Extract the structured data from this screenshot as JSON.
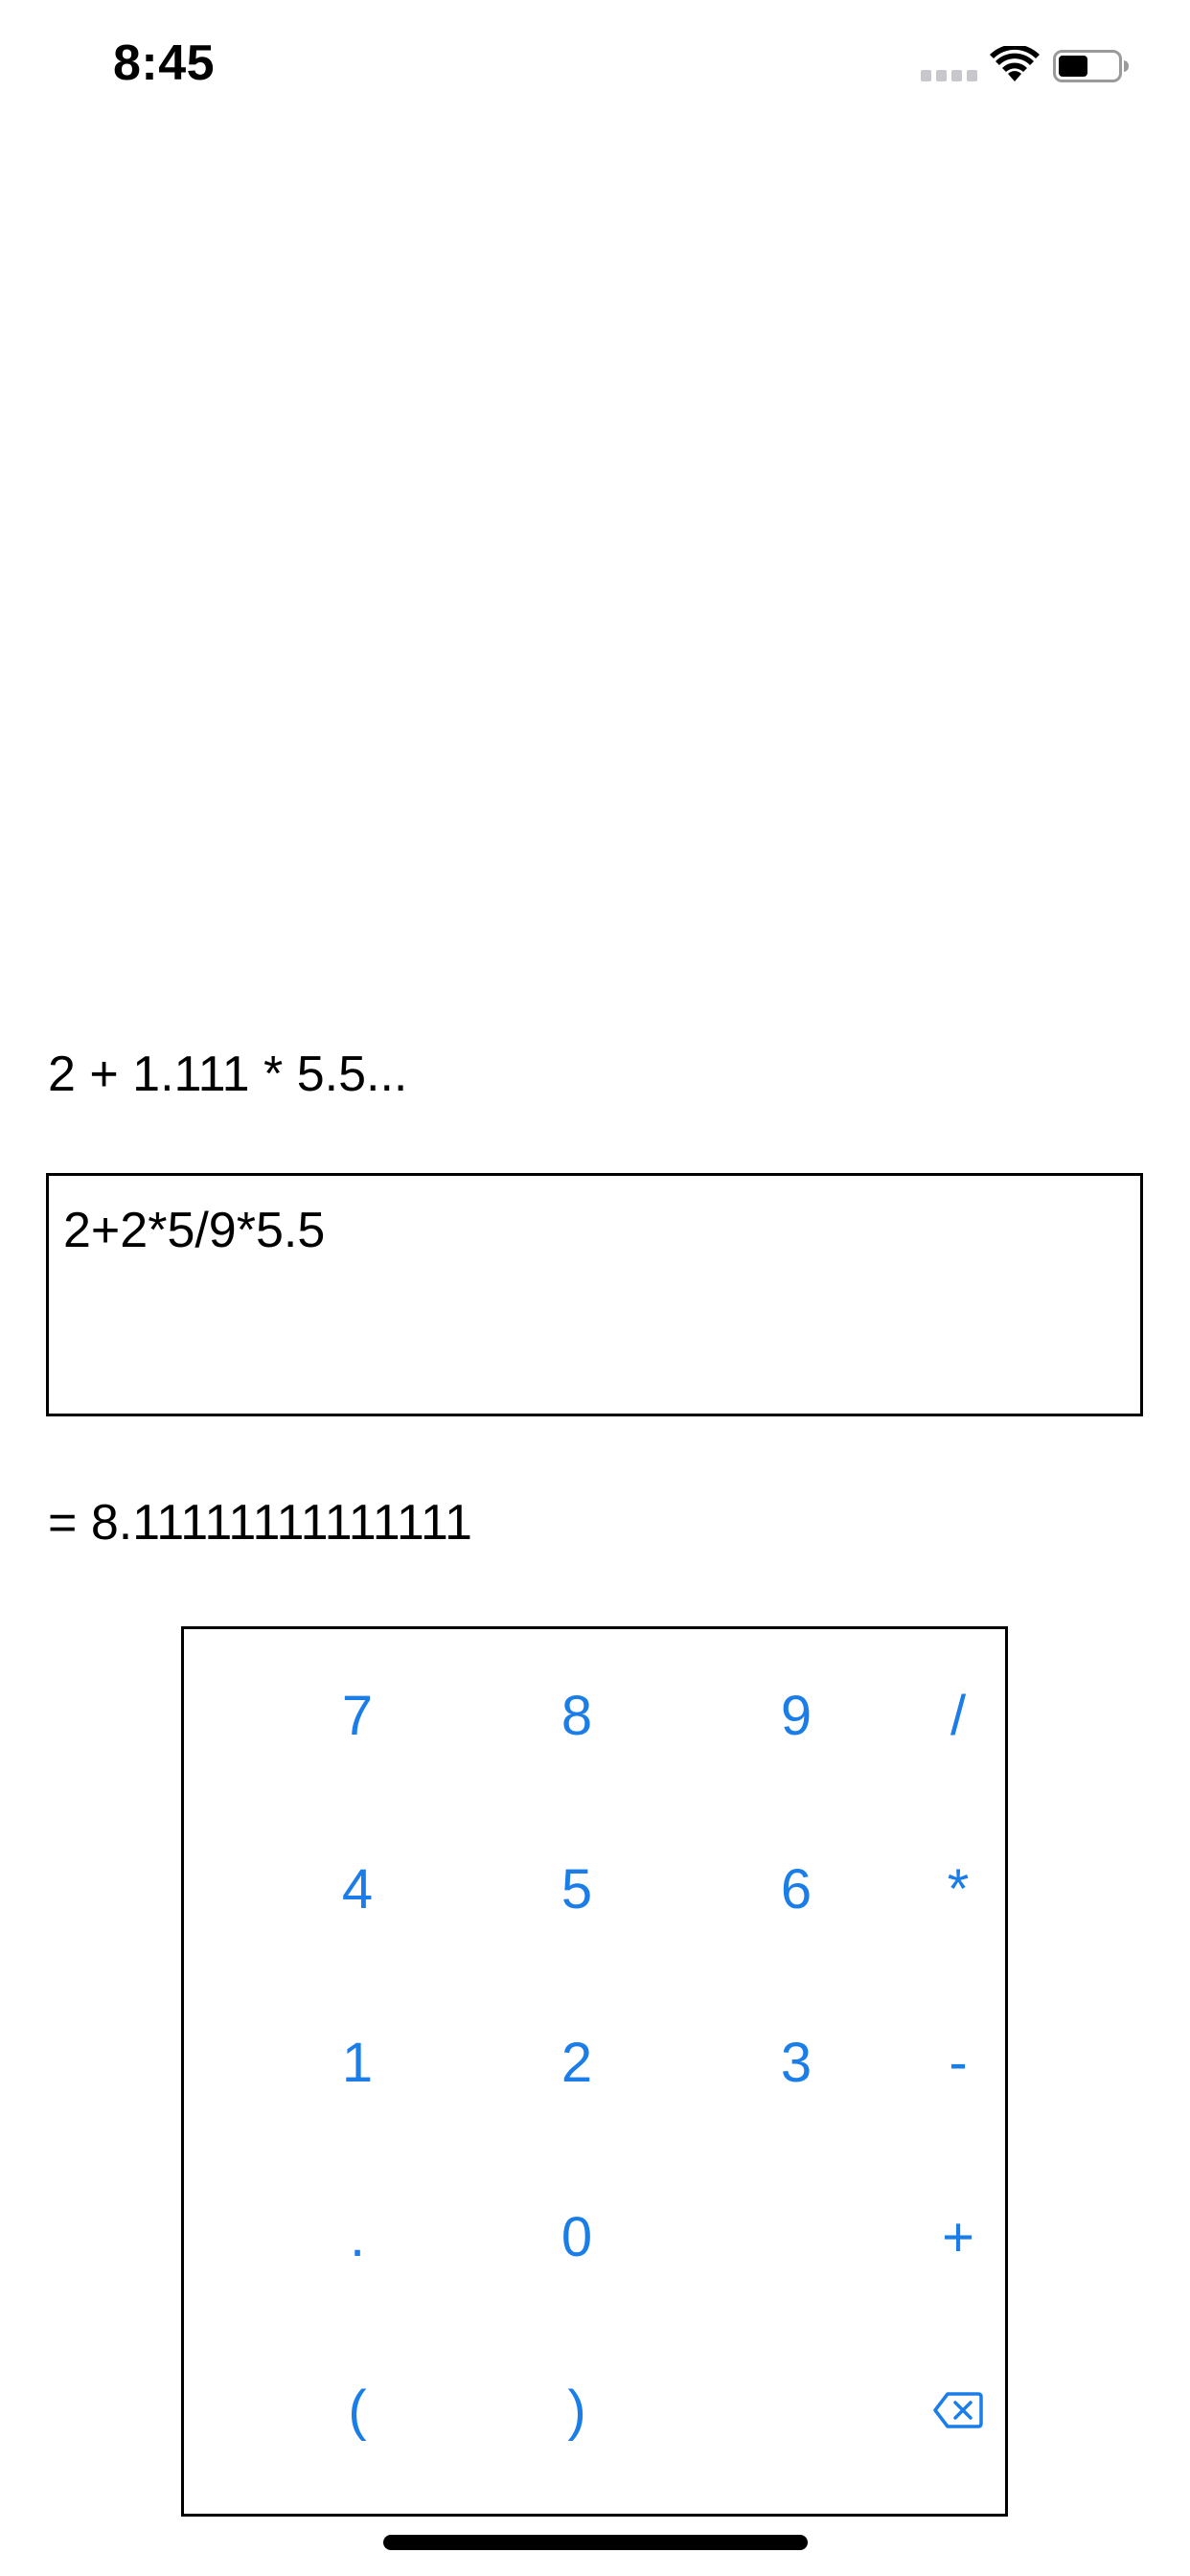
{
  "status_bar": {
    "time": "8:45"
  },
  "calculator": {
    "preview": "2 + 1.111 * 5.5...",
    "input_value": "2+2*5/9*5.5",
    "result": "= 8.11111111111111"
  },
  "keypad": {
    "rows": [
      [
        "7",
        "8",
        "9",
        "/"
      ],
      [
        "4",
        "5",
        "6",
        "*"
      ],
      [
        "1",
        "2",
        "3",
        "-"
      ],
      [
        ".",
        "0",
        "",
        "+"
      ],
      [
        "(",
        ")",
        "",
        "backspace"
      ]
    ]
  },
  "colors": {
    "accent": "#1a7de8",
    "text": "#000000",
    "background": "#ffffff"
  },
  "icons": {
    "signal": "cellular-signal-icon",
    "wifi": "wifi-icon",
    "battery": "battery-icon",
    "backspace": "backspace-icon"
  }
}
